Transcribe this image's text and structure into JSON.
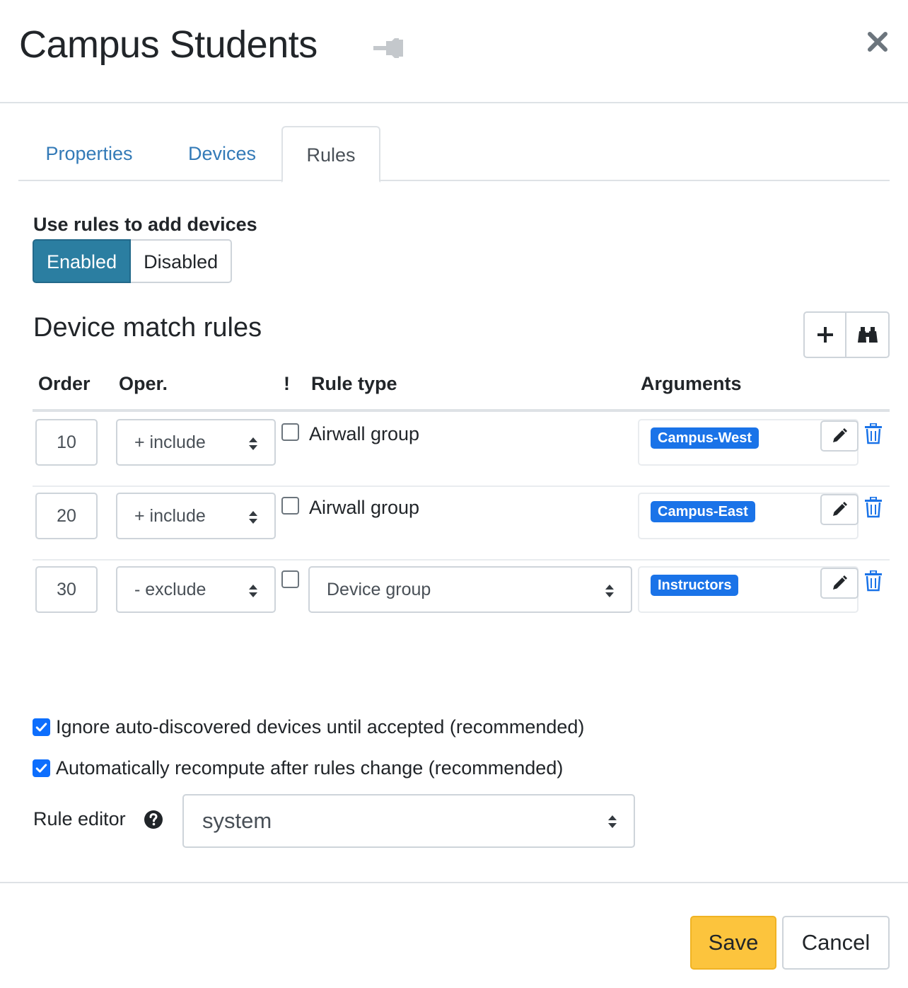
{
  "modal": {
    "title": "Campus Students",
    "icons": {
      "pin": "pin-icon",
      "close": "close-icon"
    }
  },
  "tabs": [
    {
      "label": "Properties",
      "active": false
    },
    {
      "label": "Devices",
      "active": false
    },
    {
      "label": "Rules",
      "active": true
    }
  ],
  "rules_toggle": {
    "label": "Use rules to add devices",
    "enabled_label": "Enabled",
    "disabled_label": "Disabled",
    "selected": "Enabled"
  },
  "match_rules": {
    "heading": "Device match rules",
    "toolbar_icons": [
      "plus-icon",
      "binoculars-icon"
    ],
    "columns": {
      "order": "Order",
      "oper": "Oper.",
      "negate": "!",
      "rule_type": "Rule type",
      "arguments": "Arguments"
    },
    "rows": [
      {
        "order": "10",
        "oper": "+ include",
        "negate": false,
        "rule_type": "Airwall group",
        "rule_type_is_select": false,
        "argument": "Campus-West"
      },
      {
        "order": "20",
        "oper": "+ include",
        "negate": false,
        "rule_type": "Airwall group",
        "rule_type_is_select": false,
        "argument": "Campus-East"
      },
      {
        "order": "30",
        "oper": "- exclude",
        "negate": false,
        "rule_type": "Device group",
        "rule_type_is_select": true,
        "argument": "Instructors"
      }
    ]
  },
  "options": {
    "ignore_auto": {
      "label": "Ignore auto-discovered devices until accepted (recommended)",
      "checked": true
    },
    "auto_recompute": {
      "label": "Automatically recompute after rules change (recommended)",
      "checked": true
    }
  },
  "rule_editor": {
    "label": "Rule editor",
    "value": "system"
  },
  "footer": {
    "save_label": "Save",
    "cancel_label": "Cancel"
  },
  "colors": {
    "primary_toggle": "#2b7ea1",
    "badge": "#1a73e8",
    "save": "#fcc43d",
    "link": "#337ab7"
  }
}
